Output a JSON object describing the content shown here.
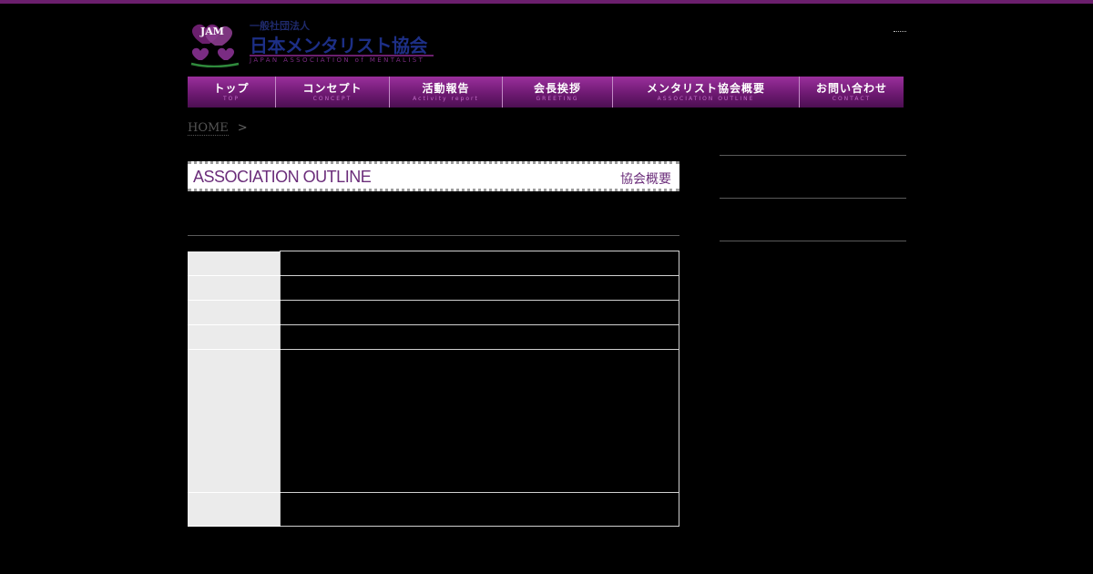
{
  "brand": {
    "logo_badge": "JAM",
    "org_type": "一般社団法人",
    "name_jp": "日本メンタリスト協会",
    "name_en": "JAPAN ASSOCIATION of MENTALIST",
    "colors": {
      "accent": "#6b1f6d",
      "nav_top": "#9a2f9c",
      "nav_bottom": "#4c0f52",
      "logo_text": "#1d2f86"
    }
  },
  "nav": {
    "items": [
      {
        "label": "トップ",
        "sub": "TOP"
      },
      {
        "label": "コンセプト",
        "sub": "CONCEPT"
      },
      {
        "label": "活動報告",
        "sub": "Activity report"
      },
      {
        "label": "会長挨拶",
        "sub": "GREETING"
      },
      {
        "label": "メンタリスト協会概要",
        "sub": "ASSOCIATION OUTLINE"
      },
      {
        "label": "お問い合わせ",
        "sub": "CONTACT"
      }
    ]
  },
  "breadcrumb": {
    "home": "HOME",
    "separator": ">"
  },
  "section": {
    "title_en": "ASSOCIATION OUTLINE",
    "title_jp": "協会概要"
  },
  "outline_table": {
    "rows": [
      {
        "label": "",
        "value": ""
      },
      {
        "label": "",
        "value": ""
      },
      {
        "label": "",
        "value": ""
      },
      {
        "label": "",
        "value": ""
      },
      {
        "label": "",
        "value": ""
      },
      {
        "label": "",
        "value": ""
      }
    ]
  }
}
